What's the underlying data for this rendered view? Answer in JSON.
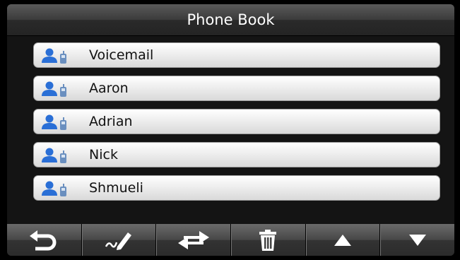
{
  "header": {
    "title": "Phone Book"
  },
  "contacts": [
    {
      "name": "Voicemail"
    },
    {
      "name": "Aaron"
    },
    {
      "name": "Adrian"
    },
    {
      "name": "Nick"
    },
    {
      "name": "Shmueli"
    }
  ],
  "toolbar": {
    "buttons": [
      {
        "icon": "back-icon"
      },
      {
        "icon": "edit-icon"
      },
      {
        "icon": "swap-icon"
      },
      {
        "icon": "trash-icon"
      },
      {
        "icon": "arrow-up-icon"
      },
      {
        "icon": "arrow-down-icon"
      }
    ]
  },
  "colors": {
    "contact_icon": "#2a6fd6",
    "bar_dark": "#2b2b2b",
    "row_light": "#eeeeee"
  }
}
